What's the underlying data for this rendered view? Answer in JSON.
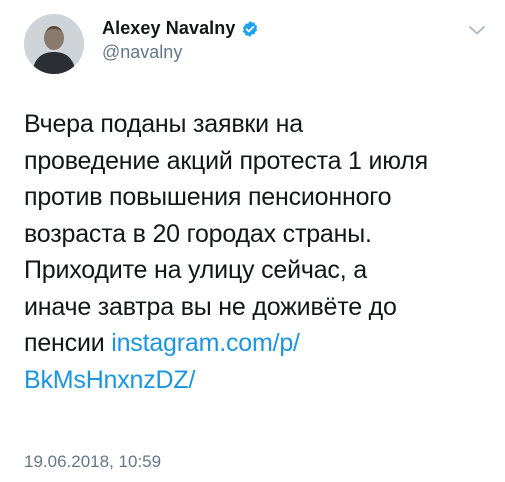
{
  "author": {
    "name": "Alexey Navalny",
    "handle": "@navalny",
    "verified": true
  },
  "tweet": {
    "lines": [
      "Вчера поданы заявки на",
      "проведение акций протеста 1 июля",
      "против повышения пенсионного",
      "возраста в 20 городах страны.",
      "Приходите на улицу сейчас, а",
      "иначе завтра вы не доживёте до"
    ],
    "last_line_prefix": "пенсии ",
    "link_part1": "instagram.com/p/",
    "link_part2": "BkMsHnxnzDZ/"
  },
  "timestamp": "19.06.2018, 10:59",
  "icons": {
    "verified": "verified-badge-icon",
    "menu": "chevron-down-icon"
  },
  "colors": {
    "link": "#1b95e0",
    "verified": "#1da1f2",
    "secondary_text": "#657786"
  }
}
